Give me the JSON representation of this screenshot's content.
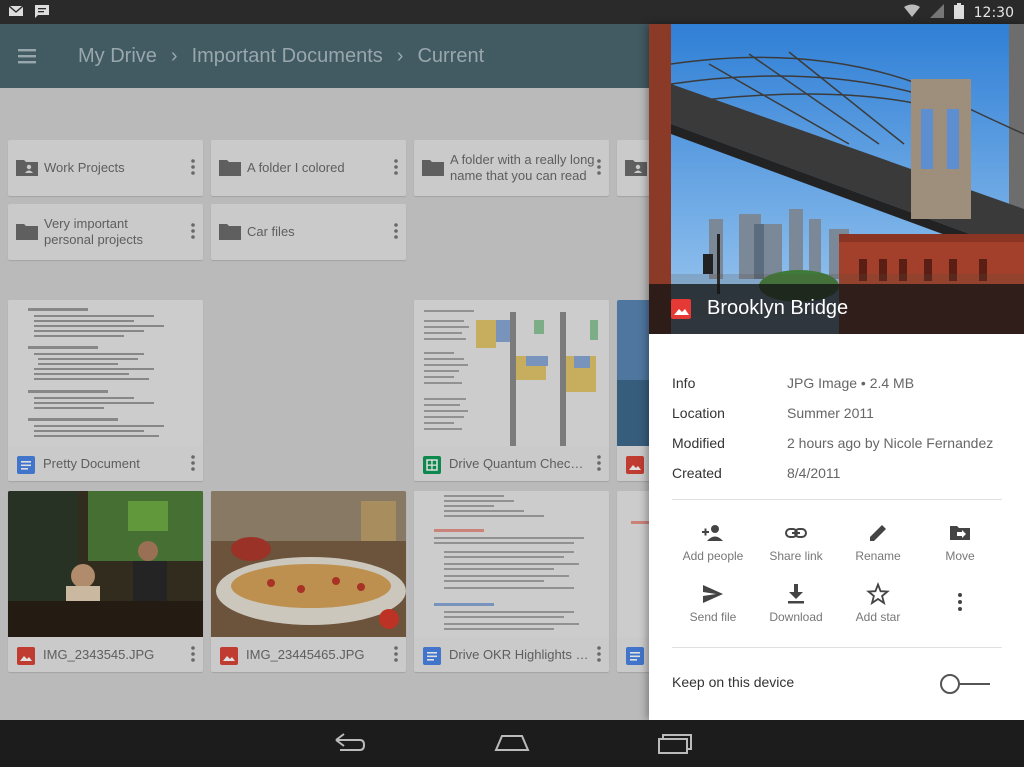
{
  "status_bar": {
    "left_icons": [
      "mail-icon",
      "chat-icon"
    ],
    "right_icons": [
      "wifi-icon",
      "signal-icon",
      "battery-icon"
    ],
    "time": "12:30"
  },
  "app_bar": {
    "menu_icon": "hamburger-menu-icon",
    "breadcrumbs": [
      "My Drive",
      "Important Documents",
      "Current"
    ],
    "color": "#4c6770"
  },
  "folders": [
    {
      "name": "Work Projects",
      "icon": "shared-folder-icon"
    },
    {
      "name": "A folder I colored",
      "icon": "folder-icon"
    },
    {
      "name": "A folder with a really long name that you can read",
      "icon": "folder-icon"
    },
    {
      "name": "",
      "icon": "shared-folder-icon"
    },
    {
      "name": "Very important personal projects",
      "icon": "folder-icon"
    },
    {
      "name": "Car files",
      "icon": "folder-icon"
    }
  ],
  "files": [
    {
      "name": "Pretty Document",
      "type": "doc",
      "type_color": "#4a86e8"
    },
    {
      "name": "Drive Quantum Chechli...",
      "type": "sheet",
      "type_color": "#0f9d58"
    },
    {
      "name": "",
      "type": "image",
      "type_color": "#db4437"
    },
    {
      "name": "IMG_2343545.JPG",
      "type": "image",
      "type_color": "#db4437"
    },
    {
      "name": "IMG_23445465.JPG",
      "type": "image",
      "type_color": "#db4437"
    },
    {
      "name": "Drive OKR Highlights Q...",
      "type": "doc",
      "type_color": "#4a86e8"
    },
    {
      "name": "",
      "type": "doc",
      "type_color": "#4a86e8"
    }
  ],
  "details": {
    "title": "Brooklyn Bridge",
    "title_icon": "image-file-icon",
    "info": [
      {
        "label": "Info",
        "value": "JPG Image • 2.4 MB"
      },
      {
        "label": "Location",
        "value": "Summer 2011"
      },
      {
        "label": "Modified",
        "value": "2 hours ago by Nicole Fernandez"
      },
      {
        "label": "Created",
        "value": "8/4/2011"
      }
    ],
    "actions": [
      {
        "label": "Add people",
        "icon": "add-person-icon"
      },
      {
        "label": "Share link",
        "icon": "link-icon"
      },
      {
        "label": "Rename",
        "icon": "pencil-icon"
      },
      {
        "label": "Move",
        "icon": "move-folder-icon"
      },
      {
        "label": "Send file",
        "icon": "send-icon"
      },
      {
        "label": "Download",
        "icon": "download-icon"
      },
      {
        "label": "Add star",
        "icon": "star-outline-icon"
      },
      {
        "label": "",
        "icon": "more-vertical-icon"
      }
    ],
    "keep_on_device": {
      "label": "Keep on this device",
      "enabled": false
    }
  },
  "nav_bar": {
    "buttons": [
      "back-icon",
      "home-icon",
      "recent-apps-icon"
    ]
  }
}
